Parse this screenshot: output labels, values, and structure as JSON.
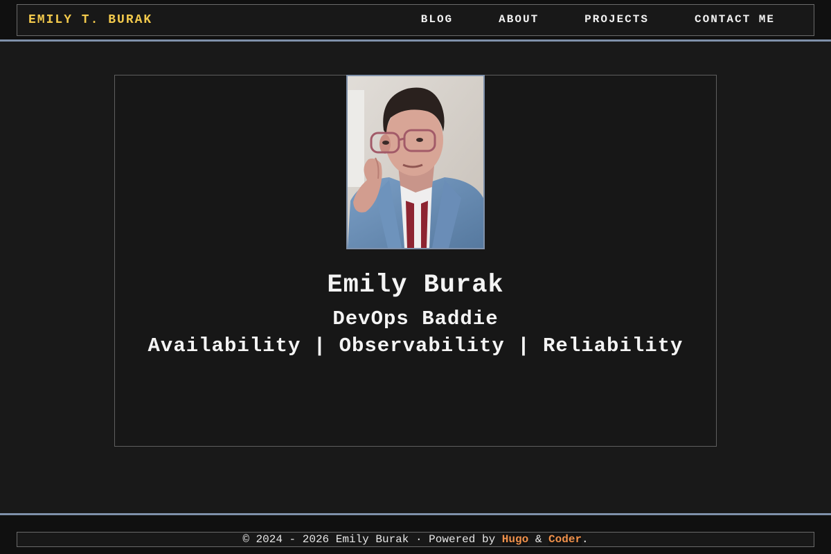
{
  "header": {
    "brand": "EMILY T. BURAK",
    "nav": [
      {
        "label": "BLOG"
      },
      {
        "label": "ABOUT"
      },
      {
        "label": "PROJECTS"
      },
      {
        "label": "CONTACT ME"
      }
    ]
  },
  "profile": {
    "name": "Emily Burak",
    "tagline_line1": "DevOps Baddie",
    "tagline_line2": "Availability | Observability | Reliability"
  },
  "footer": {
    "copyright": "© 2024 - 2026 Emily Burak · Powered by",
    "link1": "Hugo",
    "separator": "&",
    "link2": "Coder",
    "end": "."
  },
  "colors": {
    "brand": "#f2c94c",
    "accent_line": "#7f91aa",
    "link": "#f0904a",
    "background": "#191919"
  },
  "icons": {
    "avatar": "profile-photo"
  }
}
